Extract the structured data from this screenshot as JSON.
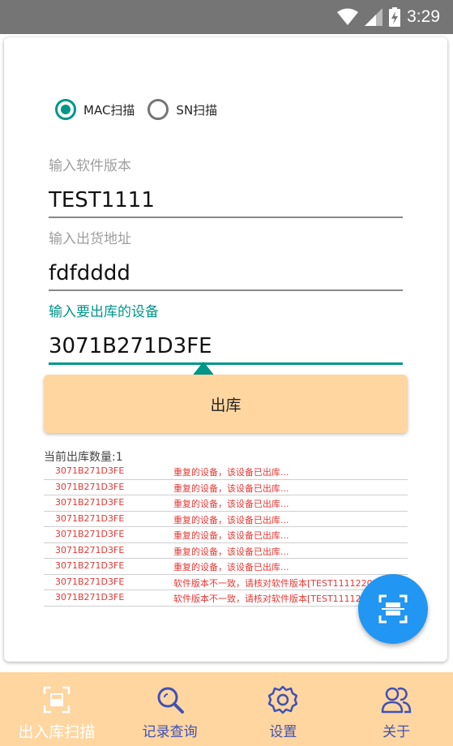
{
  "status_bar": {
    "time": "3:29"
  },
  "scan_mode": {
    "options": [
      {
        "label": "MAC扫描",
        "checked": true
      },
      {
        "label": "SN扫描",
        "checked": false
      }
    ]
  },
  "form": {
    "software_version": {
      "label": "输入软件版本",
      "value": "TEST1111"
    },
    "ship_address": {
      "label": "输入出货地址",
      "value": "fdfdddd"
    },
    "device": {
      "label": "输入要出库的设备",
      "value": "3071B271D3FE"
    }
  },
  "out_button_label": "出库",
  "count_label": "当前出库数量:1",
  "log": [
    {
      "mac": "3071B271D3FE",
      "message": "重复的设备，该设备已出库..."
    },
    {
      "mac": "3071B271D3FE",
      "message": "重复的设备，该设备已出库..."
    },
    {
      "mac": "3071B271D3FE",
      "message": "重复的设备，该设备已出库..."
    },
    {
      "mac": "3071B271D3FE",
      "message": "重复的设备，该设备已出库..."
    },
    {
      "mac": "3071B271D3FE",
      "message": "重复的设备，该设备已出库..."
    },
    {
      "mac": "3071B271D3FE",
      "message": "重复的设备，该设备已出库..."
    },
    {
      "mac": "3071B271D3FE",
      "message": "重复的设备，该设备已出库..."
    },
    {
      "mac": "3071B271D3FE",
      "message": "软件版本不一致，请核对软件版本[TEST1111220]..."
    },
    {
      "mac": "3071B271D3FE",
      "message": "软件版本不一致，请核对软件版本[TEST1111220]..."
    }
  ],
  "fab": {
    "icon": "scan-icon"
  },
  "bottom_nav": [
    {
      "label": "出入库扫描",
      "icon": "scan-icon",
      "active": true
    },
    {
      "label": "记录查询",
      "icon": "search-icon",
      "active": false
    },
    {
      "label": "设置",
      "icon": "gear-icon",
      "active": false
    },
    {
      "label": "关于",
      "icon": "users-icon",
      "active": false
    }
  ],
  "colors": {
    "accent": "#009688",
    "nav_background": "#ffd6a0",
    "button_background": "#ffd6a0",
    "fab": "#2196f3",
    "error_text": "#e53935",
    "nav_text": "#3f51b5"
  }
}
